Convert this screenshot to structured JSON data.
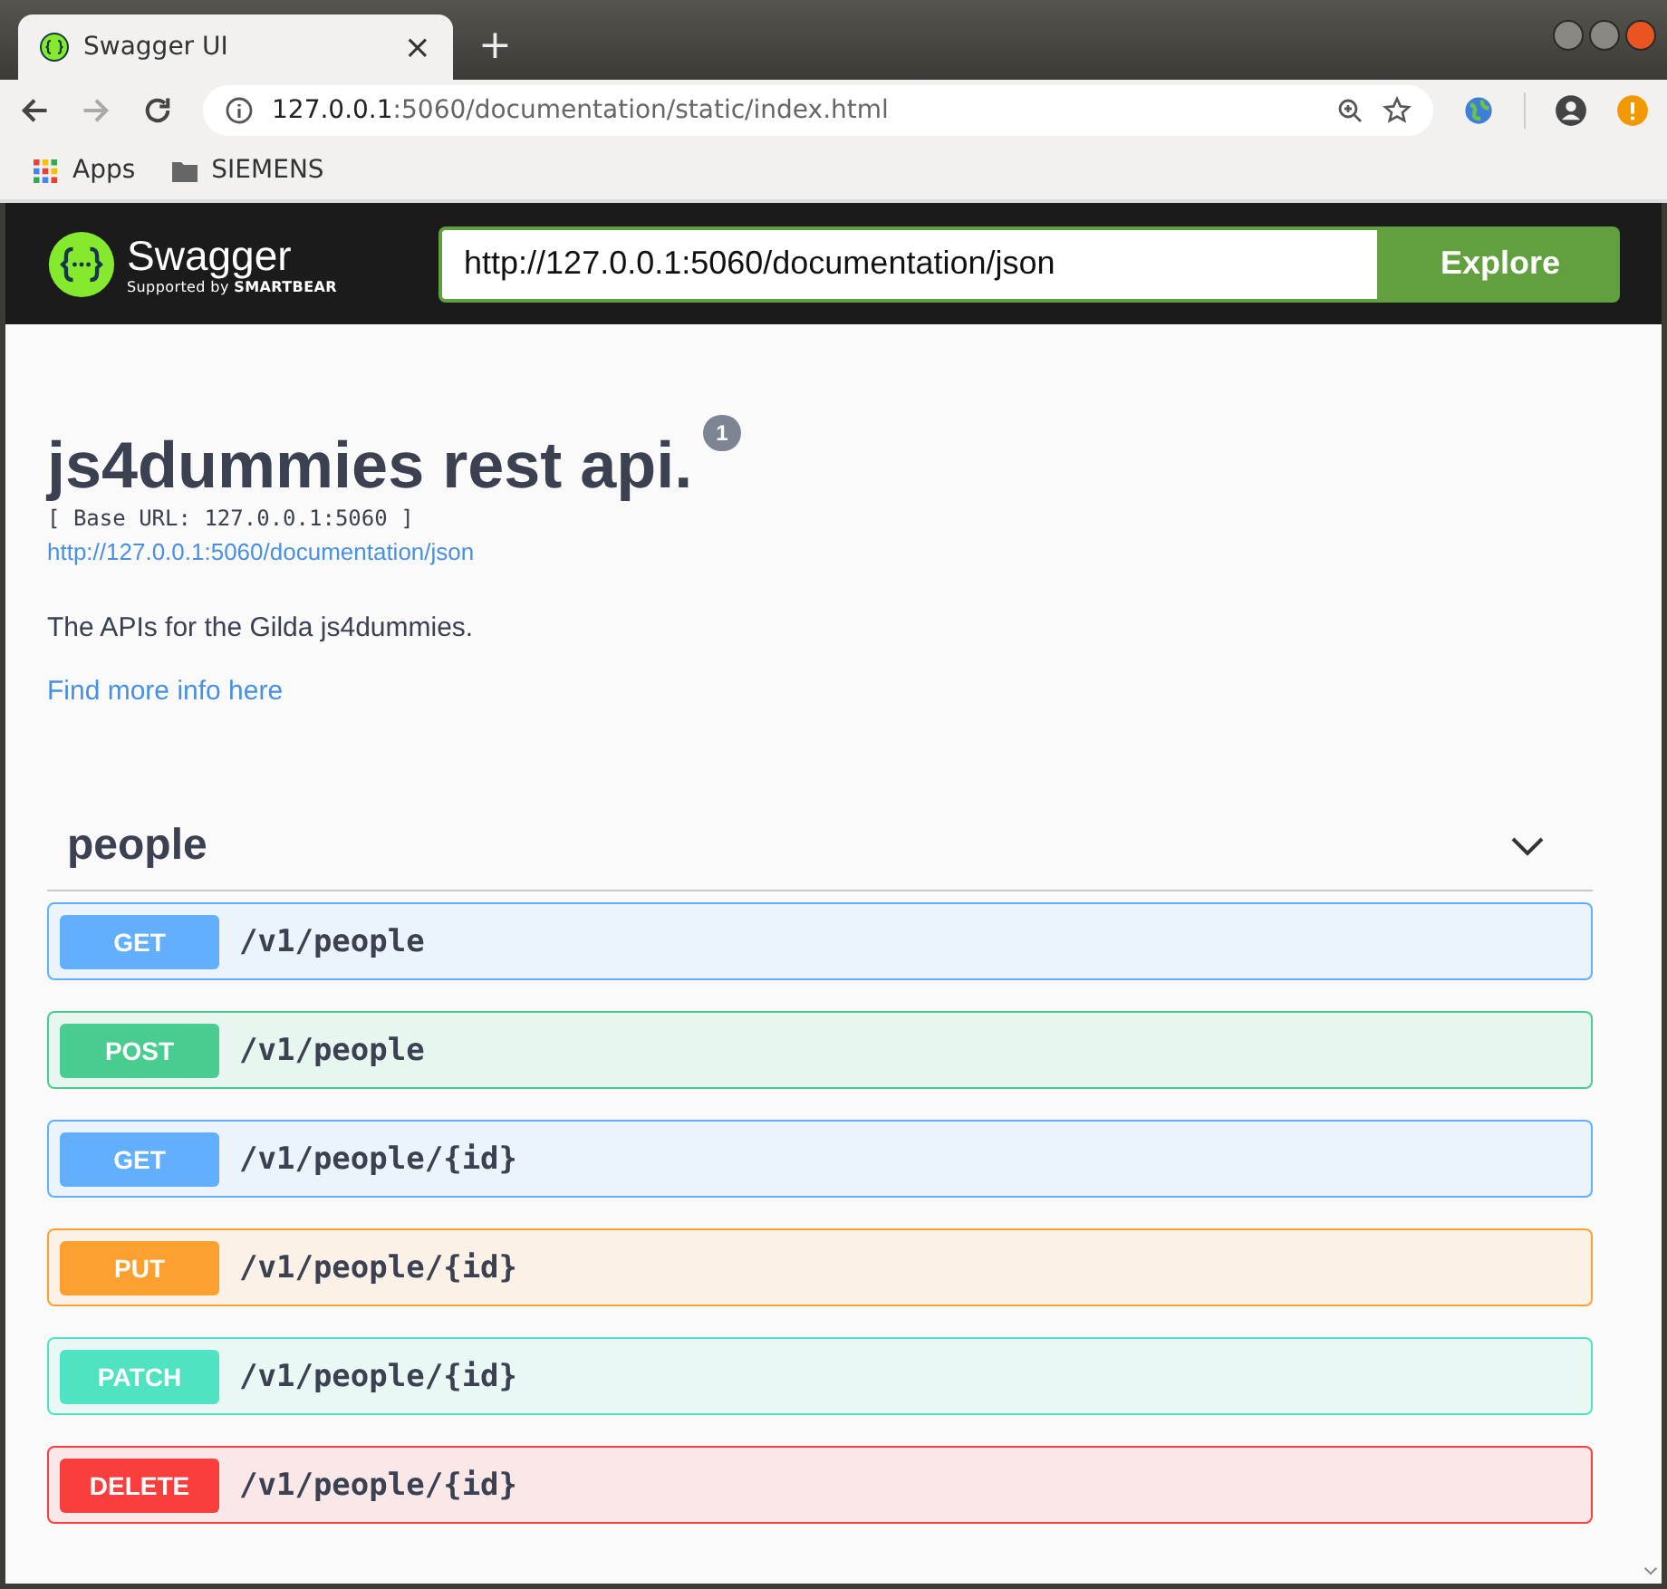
{
  "browser": {
    "tab": {
      "title": "Swagger UI",
      "close": "×"
    },
    "new_tab": "+",
    "address": {
      "host": "127.0.0.1",
      "rest": ":5060/documentation/static/index.html"
    },
    "bookmarks": [
      {
        "kind": "apps",
        "label": "Apps"
      },
      {
        "kind": "folder",
        "label": "SIEMENS"
      }
    ]
  },
  "topbar": {
    "logo_text": "Swagger",
    "logo_sub": "Supported by",
    "logo_brand": "SMARTBEAR",
    "url_value": "http://127.0.0.1:5060/documentation/json",
    "explore": "Explore"
  },
  "info": {
    "title": "js4dummies rest api.",
    "version": "1",
    "base_url": "[ Base URL: 127.0.0.1:5060 ]",
    "spec_link": "http://127.0.0.1:5060/documentation/json",
    "description": "The APIs for the Gilda js4dummies.",
    "more_link": "Find more info here"
  },
  "section": {
    "name": "people",
    "expanded": true,
    "operations": [
      {
        "kind": "get",
        "method": "GET",
        "path": "/v1/people"
      },
      {
        "kind": "post",
        "method": "POST",
        "path": "/v1/people"
      },
      {
        "kind": "get",
        "method": "GET",
        "path": "/v1/people/{id}"
      },
      {
        "kind": "put",
        "method": "PUT",
        "path": "/v1/people/{id}"
      },
      {
        "kind": "patch",
        "method": "PATCH",
        "path": "/v1/people/{id}"
      },
      {
        "kind": "delete",
        "method": "DELETE",
        "path": "/v1/people/{id}"
      }
    ]
  }
}
